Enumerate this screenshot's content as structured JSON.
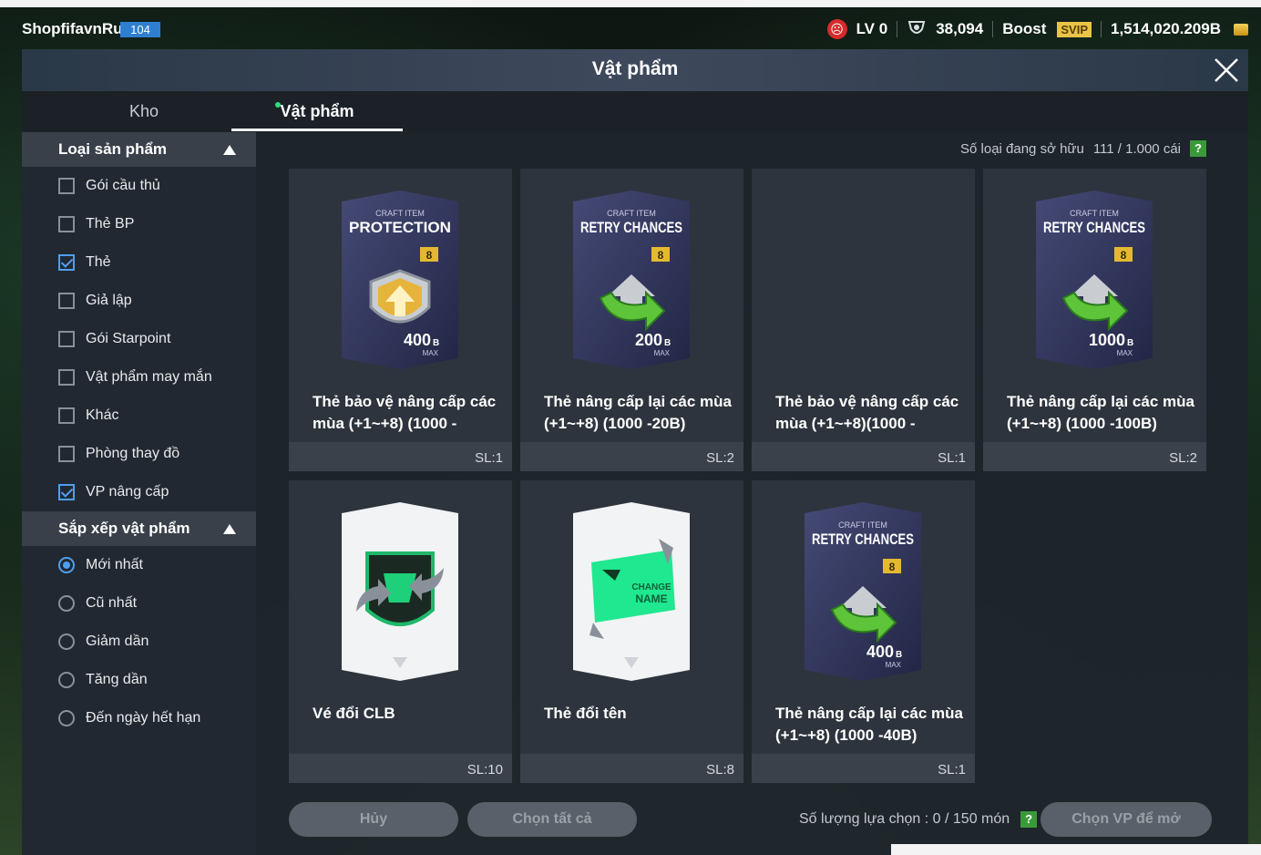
{
  "topbar": {
    "username": "ShopfifavnRut",
    "level_badge": "104",
    "lv": "LV 0",
    "trophies": "38,094",
    "boost": "Boost",
    "svip": "SVIP",
    "balance": "1,514,020.209B"
  },
  "panel": {
    "title": "Vật phẩm"
  },
  "tabs": [
    {
      "label": "Kho"
    },
    {
      "label": "Vật phẩm"
    }
  ],
  "sidebar": {
    "category_header": "Loại sản phẩm",
    "categories": [
      {
        "label": "Gói cầu thủ",
        "checked": false
      },
      {
        "label": "Thẻ BP",
        "checked": false
      },
      {
        "label": "Thẻ",
        "checked": true
      },
      {
        "label": "Giả lập",
        "checked": false
      },
      {
        "label": "Gói Starpoint",
        "checked": false
      },
      {
        "label": "Vật phẩm may mắn",
        "checked": false
      },
      {
        "label": "Khác",
        "checked": false
      },
      {
        "label": "Phòng thay đồ",
        "checked": false
      },
      {
        "label": "VP nâng cấp",
        "checked": true
      }
    ],
    "sort_header": "Sắp xếp vật phẩm",
    "sorts": [
      {
        "label": "Mới nhất",
        "selected": true
      },
      {
        "label": "Cũ nhất",
        "selected": false
      },
      {
        "label": "Giảm dần",
        "selected": false
      },
      {
        "label": "Tăng dần",
        "selected": false
      },
      {
        "label": "Đến ngày hết hạn",
        "selected": false
      }
    ]
  },
  "owned": {
    "label": "Số loại đang sở hữu",
    "value": "111 / 1.000 cái",
    "help": "?"
  },
  "items": [
    {
      "kind": "craft",
      "top": "CRAFT ITEM",
      "title": "PROTECTION",
      "level": "8",
      "amount": "400",
      "unit": "B",
      "max": "MAX",
      "icon": "shield",
      "name_l1": "Thẻ bảo vệ nâng cấp các",
      "name_l2": "mùa (+1~+8) (1000 -",
      "qty": "SL:1"
    },
    {
      "kind": "craft",
      "top": "CRAFT ITEM",
      "title": "RETRY CHANCES",
      "level": "8",
      "amount": "200",
      "unit": "B",
      "max": "MAX",
      "icon": "retry",
      "name_l1": "Thẻ nâng cấp lại các mùa",
      "name_l2": "(+1~+8) (1000 -20B)",
      "qty": "SL:2"
    },
    {
      "kind": "empty",
      "name_l1": "Thẻ bảo vệ nâng cấp các",
      "name_l2": "mùa (+1~+8)(1000 -",
      "qty": "SL:1"
    },
    {
      "kind": "craft",
      "top": "CRAFT ITEM",
      "title": "RETRY CHANCES",
      "level": "8",
      "amount": "1000",
      "unit": "B",
      "max": "MAX",
      "icon": "retry",
      "name_l1": "Thẻ nâng cấp lại các mùa",
      "name_l2": "(+1~+8) (1000 -100B)",
      "qty": "SL:2"
    },
    {
      "kind": "club",
      "name_l1": "Vé đổi CLB",
      "name_l2": "",
      "qty": "SL:10"
    },
    {
      "kind": "rename",
      "change_l1": "CHANGE",
      "change_l2": "NAME",
      "name_l1": "Thẻ đổi tên",
      "name_l2": "",
      "qty": "SL:8"
    },
    {
      "kind": "craft",
      "top": "CRAFT ITEM",
      "title": "RETRY CHANCES",
      "level": "8",
      "amount": "400",
      "unit": "B",
      "max": "MAX",
      "icon": "retry",
      "name_l1": "Thẻ nâng cấp lại các mùa",
      "name_l2": "(+1~+8) (1000 -40B)",
      "qty": "SL:1"
    }
  ],
  "bottom": {
    "cancel": "Hủy",
    "select_all": "Chọn tất cả",
    "selection_label": "Số lượng lựa chọn : 0 / 150 món",
    "help": "?",
    "open": "Chọn VP để mở"
  }
}
